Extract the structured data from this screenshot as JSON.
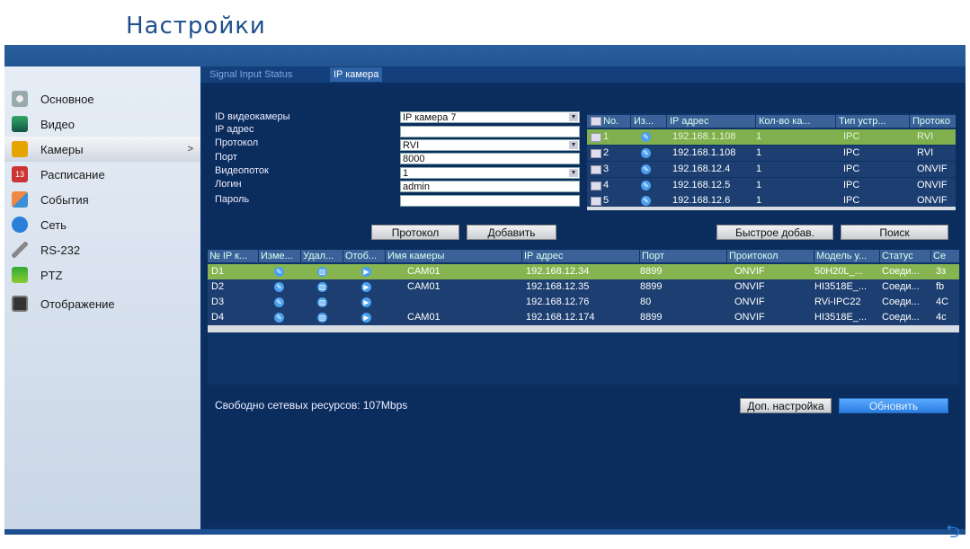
{
  "app": {
    "title": "Настройки"
  },
  "sidebar": {
    "items": [
      {
        "label": "Основное",
        "icon": "gear-icon",
        "color": "#9aa"
      },
      {
        "label": "Видео",
        "icon": "video-icon",
        "color": "#3a6"
      },
      {
        "label": "Камеры",
        "icon": "camera-icon",
        "color": "#e6a400",
        "active": true,
        "chevron": ">"
      },
      {
        "label": "Расписание",
        "icon": "calendar-icon",
        "color": "#c33"
      },
      {
        "label": "События",
        "icon": "events-icon",
        "color": "#3a8fd6"
      },
      {
        "label": "Сеть",
        "icon": "network-icon",
        "color": "#2a7fd8"
      },
      {
        "label": "RS-232",
        "icon": "rs232-icon",
        "color": "#888"
      },
      {
        "label": "PTZ",
        "icon": "ptz-icon",
        "color": "#3a3"
      },
      {
        "label": "Отображение",
        "icon": "display-icon",
        "color": "#333"
      }
    ]
  },
  "tabs": {
    "signal": "Signal Input Status",
    "ip": "IP камера"
  },
  "form": {
    "camera_id_label": "ID видеокамеры",
    "camera_id_value": "IP камера 7",
    "ip_label": "IP адрес",
    "ip_value": "",
    "protocol_label": "Протокол",
    "protocol_value": "RVI",
    "port_label": "Порт",
    "port_value": "8000",
    "stream_label": "Видеопоток",
    "stream_value": "1",
    "login_label": "Логин",
    "login_value": "admin",
    "password_label": "Пароль",
    "password_value": ""
  },
  "mini_table": {
    "headers": [
      "No.",
      "Из...",
      "IP адрес",
      "Кол-во ка...",
      "Тип устр...",
      "Протоко"
    ],
    "rows": [
      {
        "no": "1",
        "ip": "192.168.1.108",
        "count": "1",
        "type": "IPC",
        "proto": "RVI"
      },
      {
        "no": "2",
        "ip": "192.168.1.108",
        "count": "1",
        "type": "IPC",
        "proto": "RVI"
      },
      {
        "no": "3",
        "ip": "192.168.12.4",
        "count": "1",
        "type": "IPC",
        "proto": "ONVIF"
      },
      {
        "no": "4",
        "ip": "192.168.12.5",
        "count": "1",
        "type": "IPC",
        "proto": "ONVIF"
      },
      {
        "no": "5",
        "ip": "192.168.12.6",
        "count": "1",
        "type": "IPC",
        "proto": "ONVIF"
      }
    ]
  },
  "buttons": {
    "protocol": "Протокол",
    "add": "Добавить",
    "quick_add": "Быстрое добав.",
    "search": "Поиск",
    "advanced": "Доп. настройка",
    "refresh": "Обновить"
  },
  "big_table": {
    "headers": [
      "№ IP к...",
      "Изме...",
      "Удал...",
      "Отоб...",
      "Имя камеры",
      "IP адрес",
      "Порт",
      "Проитокол",
      "Модель у...",
      "Статус",
      "Се"
    ],
    "rows": [
      {
        "id": "D1",
        "name": "CAM01",
        "ip": "192.168.12.34",
        "port": "8899",
        "proto": "ONVIF",
        "model": "50H20L_...",
        "status": "Соеди...",
        "extra": "3з"
      },
      {
        "id": "D2",
        "name": "CAM01",
        "ip": "192.168.12.35",
        "port": "8899",
        "proto": "ONVIF",
        "model": "HI3518E_...",
        "status": "Соеди...",
        "extra": "fb"
      },
      {
        "id": "D3",
        "name": "",
        "ip": "192.168.12.76",
        "port": "80",
        "proto": "ONVIF",
        "model": "RVi-IPC22",
        "status": "Соеди...",
        "extra": "4С"
      },
      {
        "id": "D4",
        "name": "CAM01",
        "ip": "192.168.12.174",
        "port": "8899",
        "proto": "ONVIF",
        "model": "HI3518E_...",
        "status": "Соеди...",
        "extra": "4с"
      }
    ]
  },
  "footer": {
    "free_resources": "Свободно сетевых ресурсов: 107Mbps"
  }
}
